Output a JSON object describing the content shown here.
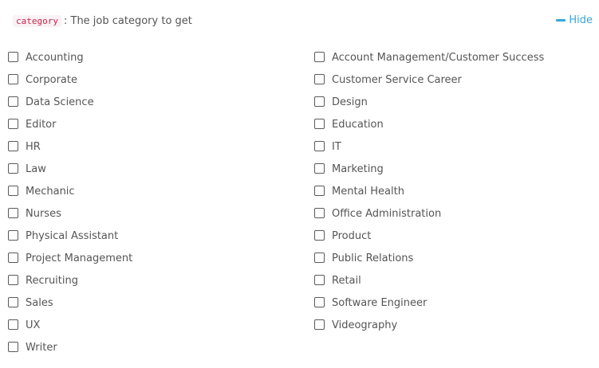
{
  "header": {
    "param_name": "category",
    "description": ": The job category to get"
  },
  "toggle": {
    "label": "Hide",
    "icon": "minus-icon"
  },
  "colors": {
    "accent": "#3aa6d6",
    "code_text": "#c7254e",
    "code_bg": "#f9f2f4"
  },
  "options_left": [
    "Accounting",
    "Corporate",
    "Data Science",
    "Editor",
    "HR",
    "Law",
    "Mechanic",
    "Nurses",
    "Physical Assistant",
    "Project Management",
    "Recruiting",
    "Sales",
    "UX",
    "Writer"
  ],
  "options_right": [
    "Account Management/Customer Success",
    "Customer Service Career",
    "Design",
    "Education",
    "IT",
    "Marketing",
    "Mental Health",
    "Office Administration",
    "Product",
    "Public Relations",
    "Retail",
    "Software Engineer",
    "Videography"
  ]
}
